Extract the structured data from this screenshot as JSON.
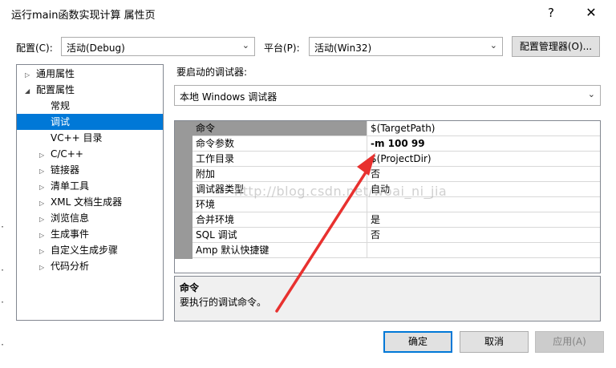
{
  "window": {
    "title": "运行main函数实现计算 属性页",
    "help": "?",
    "close": "✕"
  },
  "config": {
    "config_label": "配置(C):",
    "config_value": "活动(Debug)",
    "platform_label": "平台(P):",
    "platform_value": "活动(Win32)",
    "manager_button": "配置管理器(O)..."
  },
  "tree": {
    "items": [
      {
        "label": "通用属性",
        "toggle": "▷"
      },
      {
        "label": "配置属性",
        "toggle": "◢"
      },
      {
        "label": "常规",
        "toggle": ""
      },
      {
        "label": "调试",
        "toggle": ""
      },
      {
        "label": "VC++ 目录",
        "toggle": ""
      },
      {
        "label": "C/C++",
        "toggle": "▷"
      },
      {
        "label": "链接器",
        "toggle": "▷"
      },
      {
        "label": "清单工具",
        "toggle": "▷"
      },
      {
        "label": "XML 文档生成器",
        "toggle": "▷"
      },
      {
        "label": "浏览信息",
        "toggle": "▷"
      },
      {
        "label": "生成事件",
        "toggle": "▷"
      },
      {
        "label": "自定义生成步骤",
        "toggle": "▷"
      },
      {
        "label": "代码分析",
        "toggle": "▷"
      }
    ]
  },
  "debugger": {
    "label": "要启动的调试器:",
    "value": "本地 Windows 调试器"
  },
  "properties": {
    "rows": [
      {
        "name": "命令",
        "value": "$(TargetPath)"
      },
      {
        "name": "命令参数",
        "value": "-m 100 99"
      },
      {
        "name": "工作目录",
        "value": "$(ProjectDir)"
      },
      {
        "name": "附加",
        "value": "否"
      },
      {
        "name": "调试器类型",
        "value": "自动"
      },
      {
        "name": "环境",
        "value": ""
      },
      {
        "name": "合并环境",
        "value": "是"
      },
      {
        "name": "SQL 调试",
        "value": "否"
      },
      {
        "name": "Amp 默认快捷键",
        "value": ""
      }
    ]
  },
  "description": {
    "title": "命令",
    "text": "要执行的调试命令。"
  },
  "buttons": {
    "ok": "确定",
    "cancel": "取消",
    "apply": "应用(A)"
  },
  "watermark": "http://blog.csdn.net/woai_ni_jia",
  "colors": {
    "accent": "#0078d7",
    "arrow": "#e8312f",
    "gutter": "#999999"
  }
}
